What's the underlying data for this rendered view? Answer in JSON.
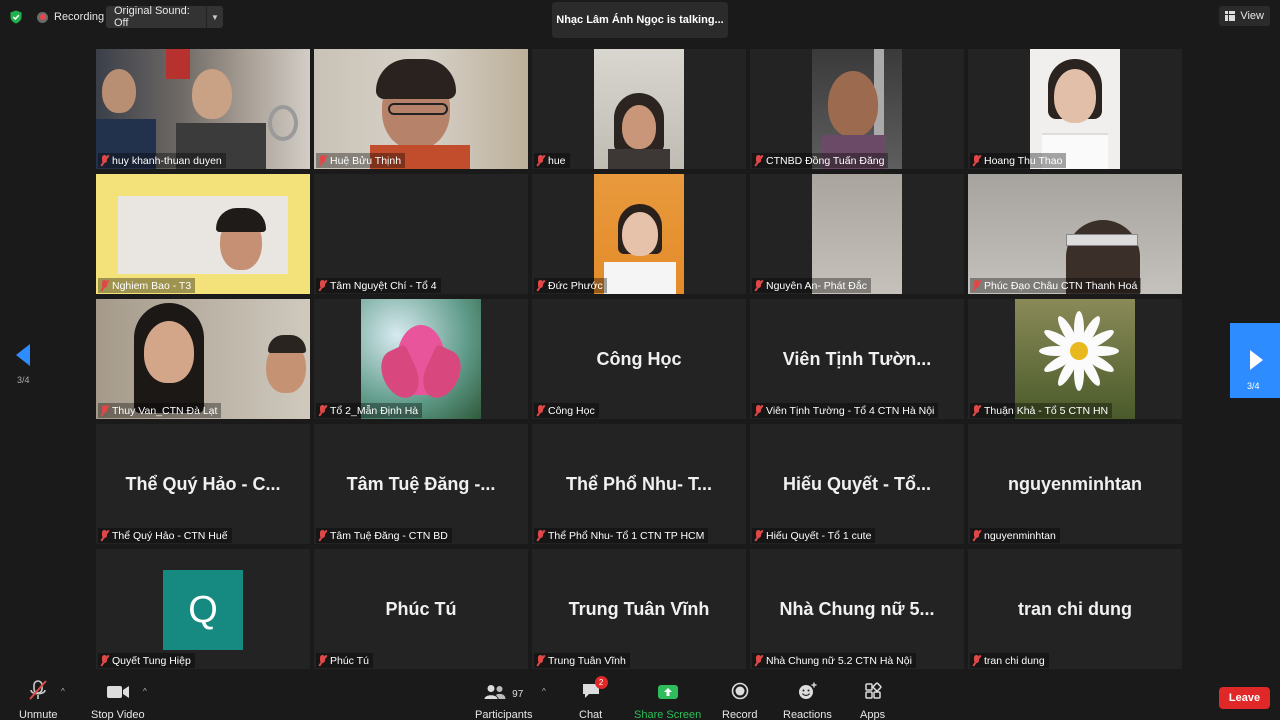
{
  "topbar": {
    "recording": "Recording",
    "original_sound": "Original Sound: Off",
    "talking": "Nhạc Lâm Ánh Ngọc is talking...",
    "view": "View"
  },
  "tiles": [
    {
      "name": "huy khanh-thuan duyen",
      "big": ""
    },
    {
      "name": "Huệ Bửu Thịnh",
      "big": ""
    },
    {
      "name": "hue",
      "big": ""
    },
    {
      "name": "CTNBD Đồng Tuấn Đăng",
      "big": ""
    },
    {
      "name": "Hoang Thu Thao",
      "big": ""
    },
    {
      "name": "Nghiem Bao - T3",
      "big": ""
    },
    {
      "name": "Tâm Nguyệt Chí - Tổ 4",
      "big": ""
    },
    {
      "name": "Đức Phước",
      "big": ""
    },
    {
      "name": "Nguyên An- Phát Đắc",
      "big": ""
    },
    {
      "name": "Phúc Đạo Châu CTN Thanh Hoá",
      "big": ""
    },
    {
      "name": "Thuy Van_CTN Đà Lạt",
      "big": ""
    },
    {
      "name": "Tổ 2_Mẫn Định Hà",
      "big": ""
    },
    {
      "name": "Công Học",
      "big": "Công Học"
    },
    {
      "name": "Viên Tịnh Tường - Tổ 4 CTN Hà Nội",
      "big": "Viên Tịnh Tườn..."
    },
    {
      "name": "Thuận Khả - Tổ 5 CTN HN",
      "big": ""
    },
    {
      "name": "Thể Quý Hảo - CTN Huế",
      "big": "Thể Quý Hảo - C..."
    },
    {
      "name": "Tâm Tuệ Đăng - CTN BD",
      "big": "Tâm Tuệ Đăng -..."
    },
    {
      "name": "Thể Phổ Nhu- Tổ 1 CTN TP HCM",
      "big": "Thể Phổ Nhu- T..."
    },
    {
      "name": "Hiếu Quyết - Tổ 1 cute",
      "big": "Hiếu Quyết - Tổ..."
    },
    {
      "name": "nguyenminhtan",
      "big": "nguyenminhtan"
    },
    {
      "name": "Quyết Tung Hiệp",
      "big": "",
      "avatar": "Q"
    },
    {
      "name": "Phúc Tú",
      "big": "Phúc Tú"
    },
    {
      "name": "Trung Tuân Vĩnh",
      "big": "Trung Tuân Vĩnh"
    },
    {
      "name": "Nhà Chung nữ 5.2 CTN Hà Nội",
      "big": "Nhà Chung nữ 5..."
    },
    {
      "name": "tran chi dung",
      "big": "tran chi dung"
    }
  ],
  "pager": {
    "left": "3/4",
    "right": "3/4"
  },
  "toolbar": {
    "unmute": "Unmute",
    "stop_video": "Stop Video",
    "participants": "Participants",
    "participants_count": "97",
    "chat": "Chat",
    "chat_badge": "2",
    "share_screen": "Share Screen",
    "record": "Record",
    "reactions": "Reactions",
    "apps": "Apps",
    "leave": "Leave"
  },
  "colors": {
    "accent": "#2d8cff",
    "share_green": "#2ebd5a",
    "leave_red": "#e02828",
    "avatar_teal": "#168a80"
  }
}
